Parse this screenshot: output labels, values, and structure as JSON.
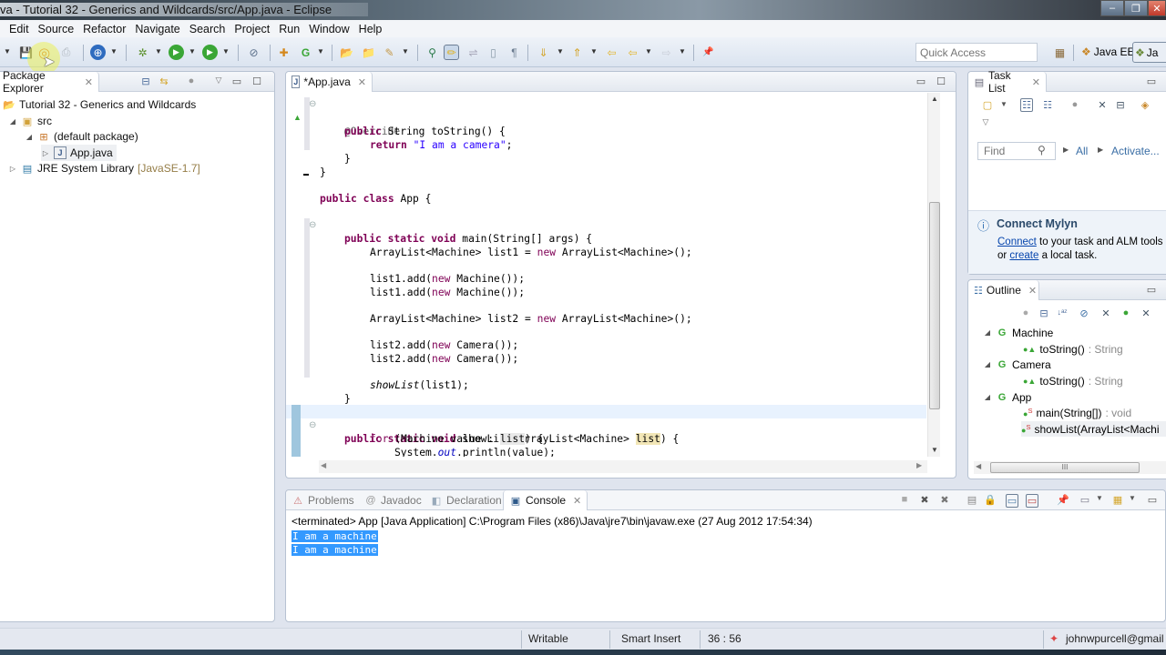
{
  "window": {
    "title": "va - Tutorial 32 - Generics and Wildcards/src/App.java - Eclipse",
    "controls": {
      "minimize": "–",
      "restore": "❐",
      "close": "✕"
    }
  },
  "menu": [
    "Edit",
    "Source",
    "Refactor",
    "Navigate",
    "Search",
    "Project",
    "Run",
    "Window",
    "Help"
  ],
  "toolbar": {
    "quick_access_placeholder": "Quick Access",
    "perspectives": {
      "java_ee": "Java EE",
      "java": "Ja"
    },
    "icons": {
      "save": "💾",
      "save_all": "◎",
      "print": "⎙",
      "new_wizard": "⊕",
      "debug": "✲",
      "run": "▶",
      "external_tools": "▶",
      "skip_breakpoints": "⊘",
      "new_java_project": "✚",
      "new_class": "G",
      "open_type": "📂",
      "open_task": "📁",
      "search": "✎",
      "toggle_mark": "⚲",
      "highlight": "✏",
      "next_annotation": "⇓",
      "prev_annotation": "⇑",
      "last_edit": "⇦",
      "back": "⇦",
      "forward": "⇨",
      "pin": "📌",
      "open_perspective": "▦"
    }
  },
  "package_explorer": {
    "tab_label": "Package Explorer",
    "tree": [
      {
        "label": "Tutorial 32 - Generics and Wildcards",
        "level": 0,
        "icon": "project-folder",
        "twisty": ""
      },
      {
        "label": "src",
        "level": 1,
        "icon": "source-folder",
        "twisty": "◢"
      },
      {
        "label": "(default package)",
        "level": 2,
        "icon": "package",
        "twisty": "◢"
      },
      {
        "label": "App.java",
        "level": 3,
        "icon": "java-file",
        "twisty": "▷"
      },
      {
        "label": "JRE System Library",
        "suffix": "[JavaSE-1.7]",
        "level": 0,
        "icon": "library",
        "twisty": "▷"
      }
    ]
  },
  "editor": {
    "tab_label": "*App.java",
    "lines": [
      {
        "t": "@Override",
        "indent": 1
      },
      {
        "t": "public String toString() {",
        "indent": 1
      },
      {
        "t": "return \"I am a camera\";",
        "indent": 2
      },
      {
        "t": "}",
        "indent": 1
      },
      {
        "t": "}",
        "indent": 0
      },
      {
        "t": "",
        "indent": 0
      },
      {
        "t": "public class App {",
        "indent": 0
      },
      {
        "t": "",
        "indent": 0
      },
      {
        "t": "public static void main(String[] args) {",
        "indent": 1
      },
      {
        "t": "",
        "indent": 0
      },
      {
        "t": "ArrayList<Machine> list1 = new ArrayList<Machine>();",
        "indent": 2
      },
      {
        "t": "",
        "indent": 0
      },
      {
        "t": "list1.add(new Machine());",
        "indent": 2
      },
      {
        "t": "list1.add(new Machine());",
        "indent": 2
      },
      {
        "t": "",
        "indent": 0
      },
      {
        "t": "ArrayList<Machine> list2 = new ArrayList<Machine>();",
        "indent": 2
      },
      {
        "t": "",
        "indent": 0
      },
      {
        "t": "list2.add(new Camera());",
        "indent": 2
      },
      {
        "t": "list2.add(new Camera());",
        "indent": 2
      },
      {
        "t": "",
        "indent": 0
      },
      {
        "t": "showList(list1);",
        "indent": 2
      },
      {
        "t": "}",
        "indent": 1
      },
      {
        "t": "",
        "indent": 0
      },
      {
        "t": "public static void showList(ArrayList<Machine> list) {",
        "indent": 1
      },
      {
        "t": "for (Machine value : list) {",
        "indent": 2
      },
      {
        "t": "System.out.println(value);",
        "indent": 3
      },
      {
        "t": "}",
        "indent": 2
      }
    ]
  },
  "bottom_tabs": [
    "Problems",
    "Javadoc",
    "Declaration",
    "Console"
  ],
  "console": {
    "header": "<terminated> App [Java Application] C:\\Program Files (x86)\\Java\\jre7\\bin\\javaw.exe (27 Aug 2012 17:54:34)",
    "output": [
      "I am a machine",
      "I am a machine"
    ]
  },
  "task_list": {
    "tab_label": "Task List",
    "find_placeholder": "Find",
    "filters": [
      "All",
      "Activate..."
    ],
    "mylyn": {
      "title": "Connect Mylyn",
      "connect_link": "Connect",
      "line1_rest": " to your task and ALM tools",
      "line2_prefix": "or ",
      "create_link": "create",
      "line2_rest": " a local task."
    }
  },
  "outline": {
    "tab_label": "Outline",
    "items": [
      {
        "label": "Machine",
        "type": "",
        "kind": "class",
        "level": 0
      },
      {
        "label": "toString()",
        "type": " : String",
        "kind": "method",
        "level": 1
      },
      {
        "label": "Camera",
        "type": "",
        "kind": "class",
        "level": 0
      },
      {
        "label": "toString()",
        "type": " : String",
        "kind": "method",
        "level": 1
      },
      {
        "label": "App",
        "type": "",
        "kind": "class",
        "level": 0
      },
      {
        "label": "main(String[])",
        "type": " : void",
        "kind": "static-method",
        "level": 1
      },
      {
        "label": "showList(ArrayList<Machi",
        "type": "",
        "kind": "static-method",
        "level": 1
      }
    ]
  },
  "status_bar": {
    "writable": "Writable",
    "insert_mode": "Smart Insert",
    "position": "36 : 56",
    "account": "johnwpurcell@gmail"
  },
  "colors": {
    "keyword": "#7f0055",
    "string": "#2a00ff",
    "selection": "#3399ff",
    "link": "#0645ad"
  }
}
